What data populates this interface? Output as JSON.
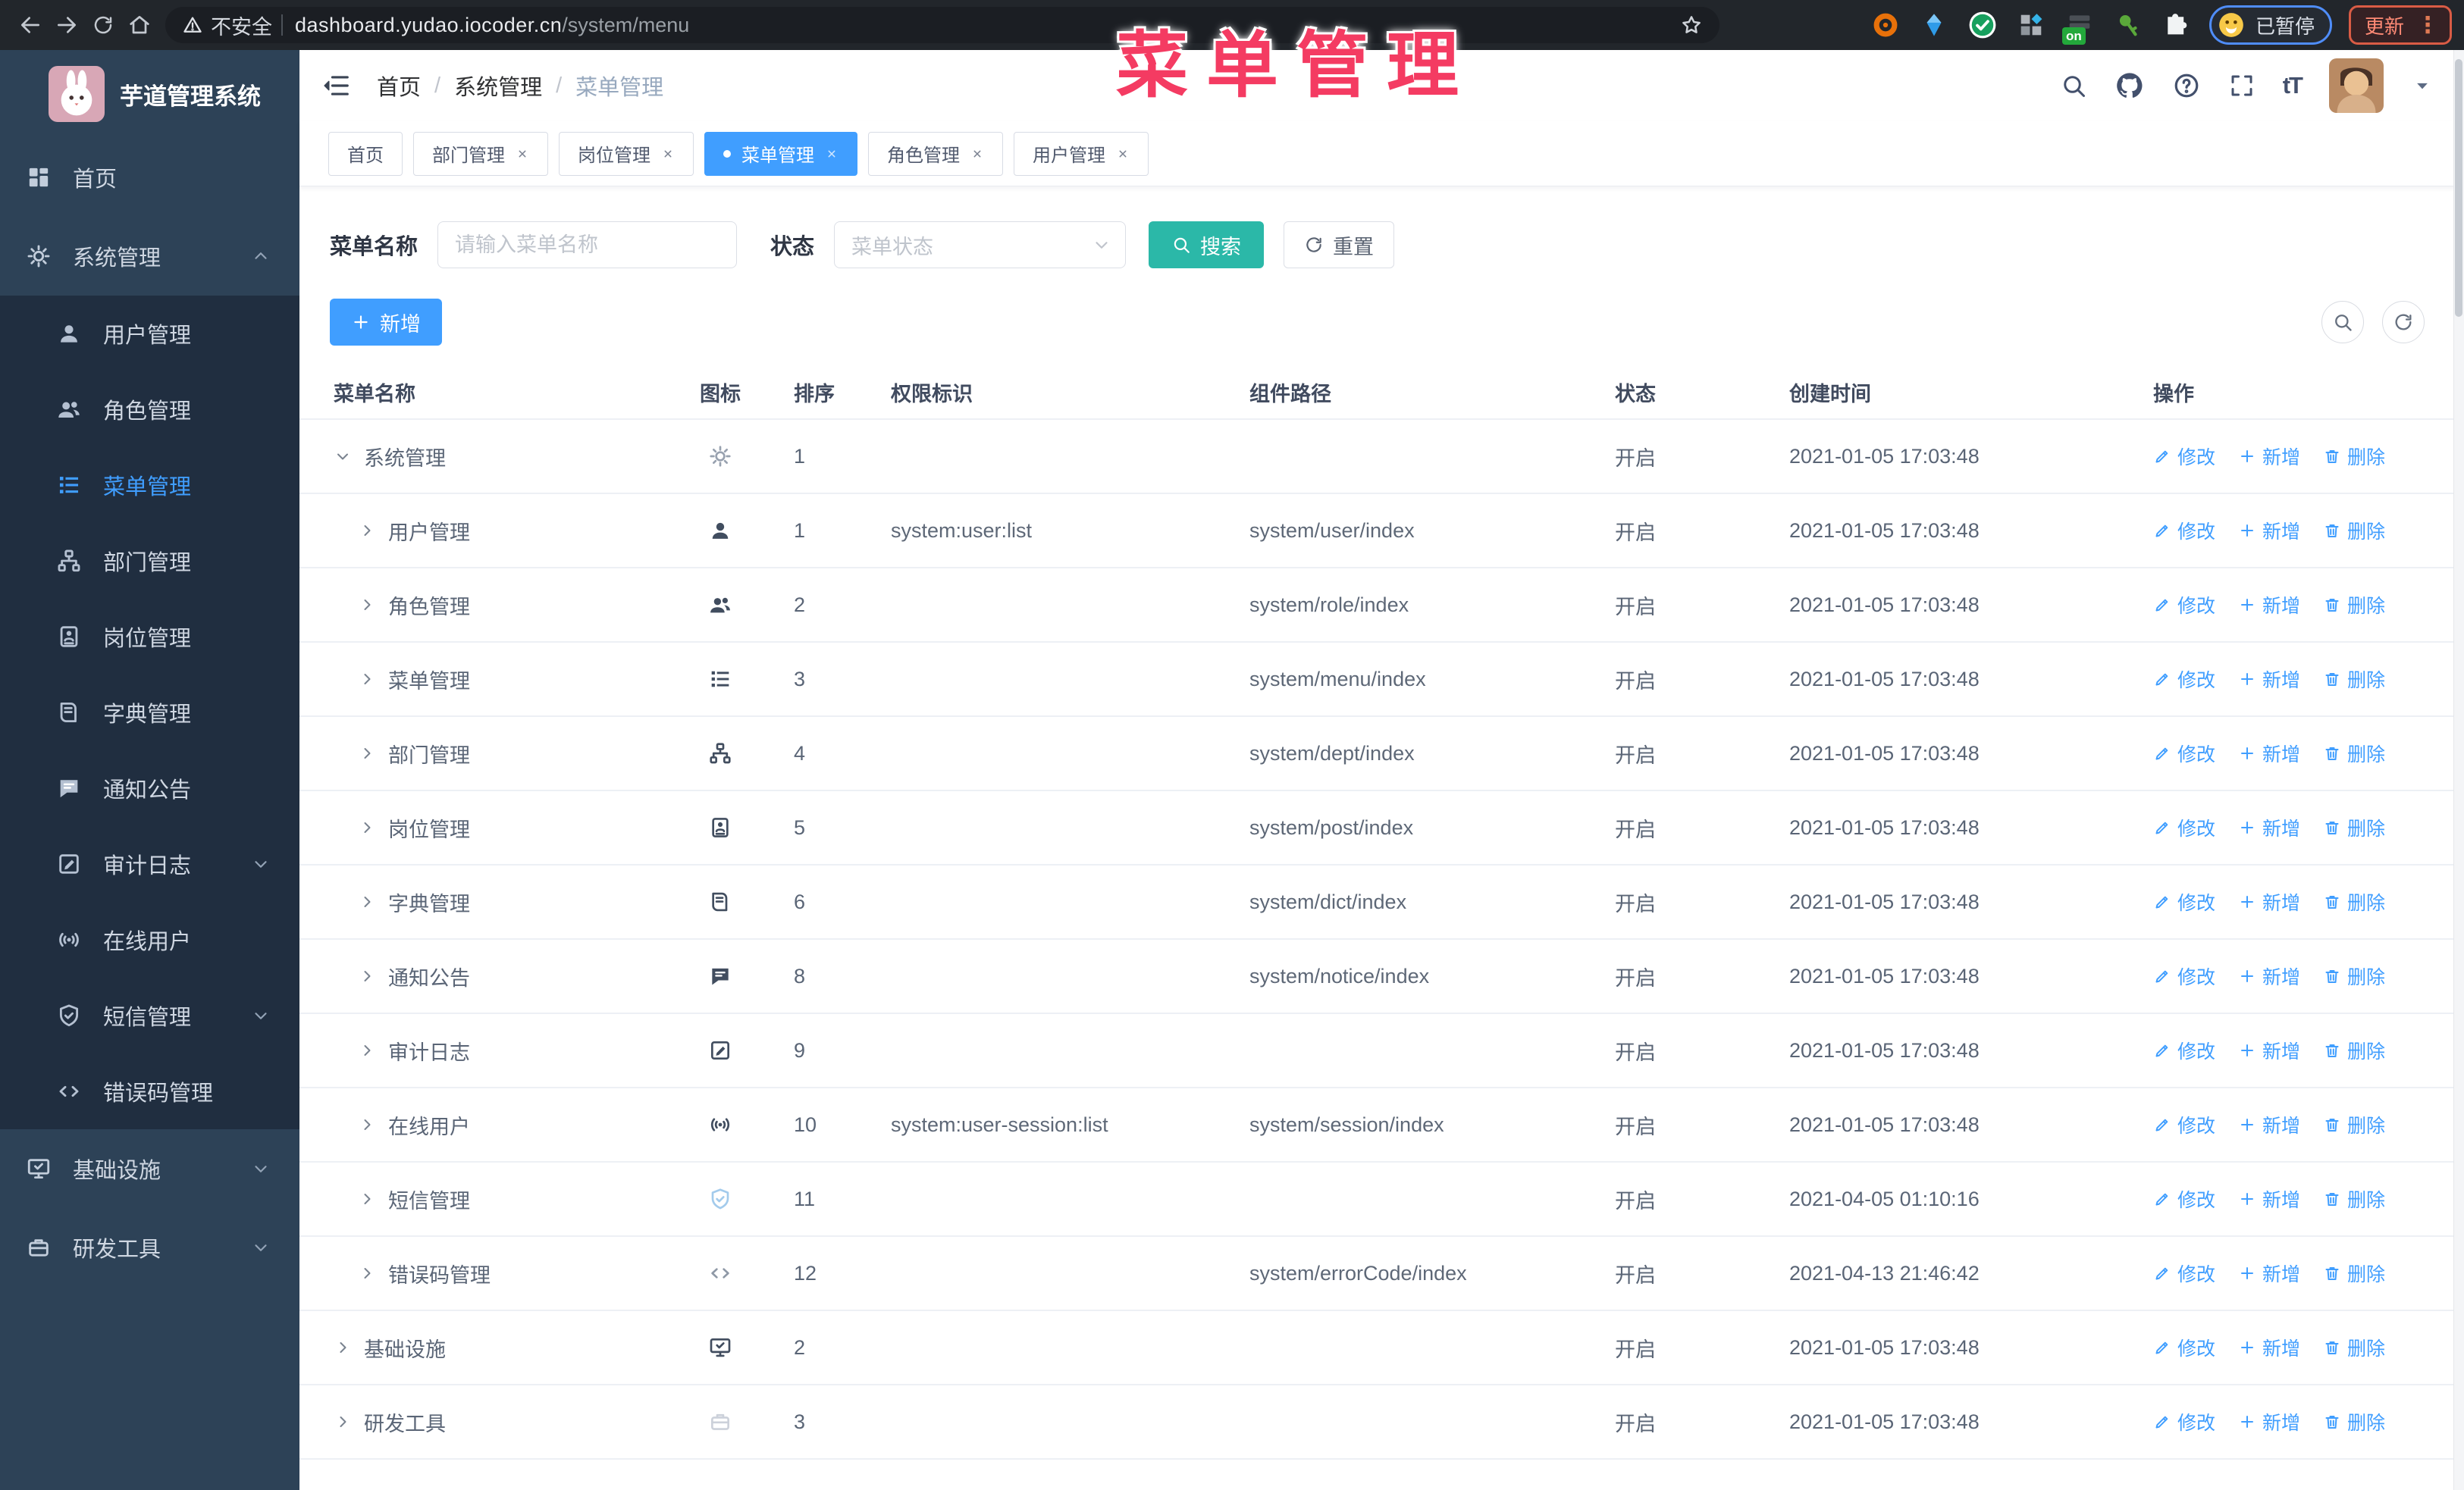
{
  "browser": {
    "not_secure_label": "不安全",
    "url_host": "dashboard.yudao.iocoder.cn",
    "url_path": "/system/menu",
    "extensions": [
      {
        "id": "orange-ring",
        "icon": "ext-orange-ring"
      },
      {
        "id": "blue-gem",
        "icon": "ext-blue-gem"
      },
      {
        "id": "green-check",
        "icon": "ext-green-check"
      },
      {
        "id": "grid-blue",
        "icon": "ext-grid-blue"
      },
      {
        "id": "dark-on",
        "icon": "ext-dark-on",
        "badge": "on"
      },
      {
        "id": "green-key",
        "icon": "ext-green-key"
      },
      {
        "id": "puzzle",
        "icon": "ext-puzzle"
      }
    ],
    "profile_label": "已暂停",
    "update_label": "更新"
  },
  "overlay_title": "菜单管理",
  "sidebar": {
    "app_title": "芋道管理系统",
    "items": [
      {
        "id": "home",
        "label": "首页",
        "icon": "dashboard",
        "type": "top"
      },
      {
        "id": "system",
        "label": "系统管理",
        "icon": "gear",
        "type": "top",
        "chevron": "up"
      },
      {
        "id": "user",
        "label": "用户管理",
        "icon": "user",
        "type": "sub"
      },
      {
        "id": "role",
        "label": "角色管理",
        "icon": "users",
        "type": "sub"
      },
      {
        "id": "menu",
        "label": "菜单管理",
        "icon": "menu-list",
        "type": "sub",
        "active": true
      },
      {
        "id": "dept",
        "label": "部门管理",
        "icon": "org",
        "type": "sub"
      },
      {
        "id": "post",
        "label": "岗位管理",
        "icon": "badge",
        "type": "sub"
      },
      {
        "id": "dict",
        "label": "字典管理",
        "icon": "book",
        "type": "sub"
      },
      {
        "id": "notice",
        "label": "通知公告",
        "icon": "chat",
        "type": "sub"
      },
      {
        "id": "audit-log",
        "label": "审计日志",
        "icon": "log",
        "type": "sub",
        "chevron": "down"
      },
      {
        "id": "online-user",
        "label": "在线用户",
        "icon": "online",
        "type": "sub"
      },
      {
        "id": "sms",
        "label": "短信管理",
        "icon": "shield",
        "type": "sub",
        "chevron": "down"
      },
      {
        "id": "error-code",
        "label": "错误码管理",
        "icon": "code",
        "type": "sub"
      },
      {
        "id": "infra",
        "label": "基础设施",
        "icon": "infra",
        "type": "top",
        "chevron": "down"
      },
      {
        "id": "dev-tools",
        "label": "研发工具",
        "icon": "tools",
        "type": "top",
        "chevron": "down"
      }
    ]
  },
  "header": {
    "breadcrumb": [
      "首页",
      "系统管理",
      "菜单管理"
    ]
  },
  "tabs": [
    {
      "id": "home",
      "label": "首页",
      "closable": false,
      "active": false
    },
    {
      "id": "dept",
      "label": "部门管理",
      "closable": true,
      "active": false
    },
    {
      "id": "post",
      "label": "岗位管理",
      "closable": true,
      "active": false
    },
    {
      "id": "menu",
      "label": "菜单管理",
      "closable": true,
      "active": true
    },
    {
      "id": "role",
      "label": "角色管理",
      "closable": true,
      "active": false
    },
    {
      "id": "user",
      "label": "用户管理",
      "closable": true,
      "active": false
    }
  ],
  "filters": {
    "name_label": "菜单名称",
    "name_placeholder": "请输入菜单名称",
    "name_value": "",
    "status_label": "状态",
    "status_placeholder": "菜单状态",
    "search_label": "搜索",
    "reset_label": "重置"
  },
  "toolbar": {
    "add_label": "新增"
  },
  "table": {
    "columns": [
      "菜单名称",
      "图标",
      "排序",
      "权限标识",
      "组件路径",
      "状态",
      "创建时间",
      "操作"
    ],
    "actions": {
      "edit": "修改",
      "add": "新增",
      "delete": "删除"
    },
    "rows": [
      {
        "id": "system",
        "name": "系统管理",
        "level": 0,
        "caret": "down",
        "icon": "gear",
        "tone": "muted",
        "sort": "1",
        "perm": "",
        "path": "",
        "status": "开启",
        "created": "2021-01-05 17:03:48"
      },
      {
        "id": "user",
        "name": "用户管理",
        "level": 1,
        "caret": "right",
        "icon": "user",
        "tone": "dark",
        "sort": "1",
        "perm": "system:user:list",
        "path": "system/user/index",
        "status": "开启",
        "created": "2021-01-05 17:03:48"
      },
      {
        "id": "role",
        "name": "角色管理",
        "level": 1,
        "caret": "right",
        "icon": "users",
        "tone": "dark",
        "sort": "2",
        "perm": "",
        "path": "system/role/index",
        "status": "开启",
        "created": "2021-01-05 17:03:48"
      },
      {
        "id": "menu",
        "name": "菜单管理",
        "level": 1,
        "caret": "right",
        "icon": "menu-list",
        "tone": "dark",
        "sort": "3",
        "perm": "",
        "path": "system/menu/index",
        "status": "开启",
        "created": "2021-01-05 17:03:48"
      },
      {
        "id": "dept",
        "name": "部门管理",
        "level": 1,
        "caret": "right",
        "icon": "org",
        "tone": "dark",
        "sort": "4",
        "perm": "",
        "path": "system/dept/index",
        "status": "开启",
        "created": "2021-01-05 17:03:48"
      },
      {
        "id": "post",
        "name": "岗位管理",
        "level": 1,
        "caret": "right",
        "icon": "badge",
        "tone": "dark",
        "sort": "5",
        "perm": "",
        "path": "system/post/index",
        "status": "开启",
        "created": "2021-01-05 17:03:48"
      },
      {
        "id": "dict",
        "name": "字典管理",
        "level": 1,
        "caret": "right",
        "icon": "book",
        "tone": "dark",
        "sort": "6",
        "perm": "",
        "path": "system/dict/index",
        "status": "开启",
        "created": "2021-01-05 17:03:48"
      },
      {
        "id": "notice",
        "name": "通知公告",
        "level": 1,
        "caret": "right",
        "icon": "chat",
        "tone": "dark",
        "sort": "8",
        "perm": "",
        "path": "system/notice/index",
        "status": "开启",
        "created": "2021-01-05 17:03:48"
      },
      {
        "id": "audit-log",
        "name": "审计日志",
        "level": 1,
        "caret": "right",
        "icon": "log",
        "tone": "dark",
        "sort": "9",
        "perm": "",
        "path": "",
        "status": "开启",
        "created": "2021-01-05 17:03:48"
      },
      {
        "id": "online-user",
        "name": "在线用户",
        "level": 1,
        "caret": "right",
        "icon": "online",
        "tone": "dark",
        "sort": "10",
        "perm": "system:user-session:list",
        "path": "system/session/index",
        "status": "开启",
        "created": "2021-01-05 17:03:48"
      },
      {
        "id": "sms",
        "name": "短信管理",
        "level": 1,
        "caret": "right",
        "icon": "shield",
        "tone": "lightblue",
        "sort": "11",
        "perm": "",
        "path": "",
        "status": "开启",
        "created": "2021-04-05 01:10:16"
      },
      {
        "id": "error-code",
        "name": "错误码管理",
        "level": 1,
        "caret": "right",
        "icon": "code",
        "tone": "muted2",
        "sort": "12",
        "perm": "",
        "path": "system/errorCode/index",
        "status": "开启",
        "created": "2021-04-13 21:46:42"
      },
      {
        "id": "infra",
        "name": "基础设施",
        "level": 0,
        "caret": "right",
        "icon": "infra",
        "tone": "dark",
        "sort": "2",
        "perm": "",
        "path": "",
        "status": "开启",
        "created": "2021-01-05 17:03:48"
      },
      {
        "id": "dev-tools",
        "name": "研发工具",
        "level": 0,
        "caret": "right",
        "icon": "tools",
        "tone": "faint",
        "sort": "3",
        "perm": "",
        "path": "",
        "status": "开启",
        "created": "2021-01-05 17:03:48"
      }
    ]
  },
  "colors": {
    "accent": "#409eff",
    "search_button": "#2bb8a8",
    "overlay_title": "#f43b62",
    "sidebar_bg": "#2d4257",
    "submenu_bg": "#202e40",
    "active_tab_bg": "#409eff"
  }
}
